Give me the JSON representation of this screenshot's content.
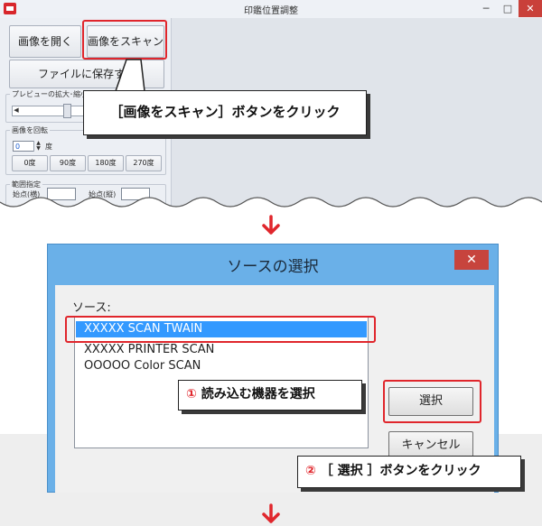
{
  "top_window": {
    "title": "印鑑位置調整",
    "controls": {
      "minimize": "─",
      "maximize": "□",
      "close": "✕"
    },
    "buttons": {
      "open_image": "画像を開く",
      "scan_image": "画像をスキャン",
      "save_file": "ファイルに保存する"
    },
    "zoom_group": {
      "label": "プレビューの拡大･縮小"
    },
    "rotate_group": {
      "label": "画像を回転",
      "value": "0",
      "unit": "度",
      "buttons": [
        "0度",
        "90度",
        "180度",
        "270度"
      ]
    },
    "range_group": {
      "label": "範囲指定",
      "start_x": "始点(横)",
      "start_y": "始点(縦)"
    }
  },
  "callouts": {
    "scan": "［画像をスキャン］ボタンをクリック",
    "choose_device_number": "①",
    "choose_device": "読み込む機器を選択",
    "click_select_number": "②",
    "click_select": "［ 選択 ］ボタンをクリック"
  },
  "dialog": {
    "title": "ソースの選択",
    "close": "✕",
    "source_label": "ソース:",
    "sources": [
      "XXXXX SCAN TWAIN",
      "XXXXX PRINTER SCAN",
      "OOOOO Color SCAN"
    ],
    "selected_index": 0,
    "select_button": "選択",
    "cancel_button": "キャンセル"
  },
  "colors": {
    "highlight": "#e0262c",
    "dialog_frame": "#6ab0e8",
    "selection": "#3399ff",
    "arrow": "#e0262c"
  }
}
